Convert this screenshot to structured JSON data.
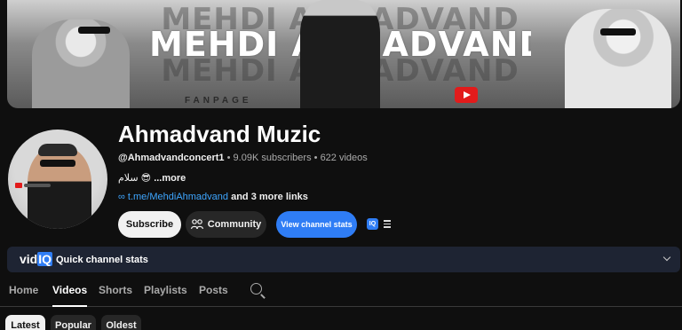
{
  "banner": {
    "title_line": "MEHDI AHMADVAND",
    "subtitle": "FANPAGE"
  },
  "channel": {
    "name": "Ahmadvand Muzic",
    "handle": "@Ahmadvandconcert1",
    "subscribers": "9.09K subscribers",
    "videos": "622 videos",
    "separator": "•",
    "description": "سلام 😎",
    "more": "...more",
    "link_icon": "∞",
    "link": "t.me/MehdiAhmadvand",
    "more_links": "and 3 more links"
  },
  "actions": {
    "subscribe": "Subscribe",
    "community": "Community",
    "view_stats": "View channel stats",
    "iq_badge": "IQ"
  },
  "vidiq": {
    "logo_main": "vid",
    "logo_iq": "IQ",
    "label": "Quick channel stats"
  },
  "tabs": [
    {
      "label": "Home",
      "active": false
    },
    {
      "label": "Videos",
      "active": true
    },
    {
      "label": "Shorts",
      "active": false
    },
    {
      "label": "Playlists",
      "active": false
    },
    {
      "label": "Posts",
      "active": false
    }
  ],
  "filters": {
    "latest": "Latest",
    "popular": "Popular",
    "oldest": "Oldest"
  },
  "colors": {
    "background": "#0f0f0f",
    "accent_blue": "#2f7df5",
    "link_blue": "#3ea6ff",
    "youtube_red": "#e21b1b"
  },
  "icons": {
    "community": "people-icon",
    "search": "search-icon",
    "menu": "hamburger-icon",
    "expand": "chevron-down-icon"
  }
}
